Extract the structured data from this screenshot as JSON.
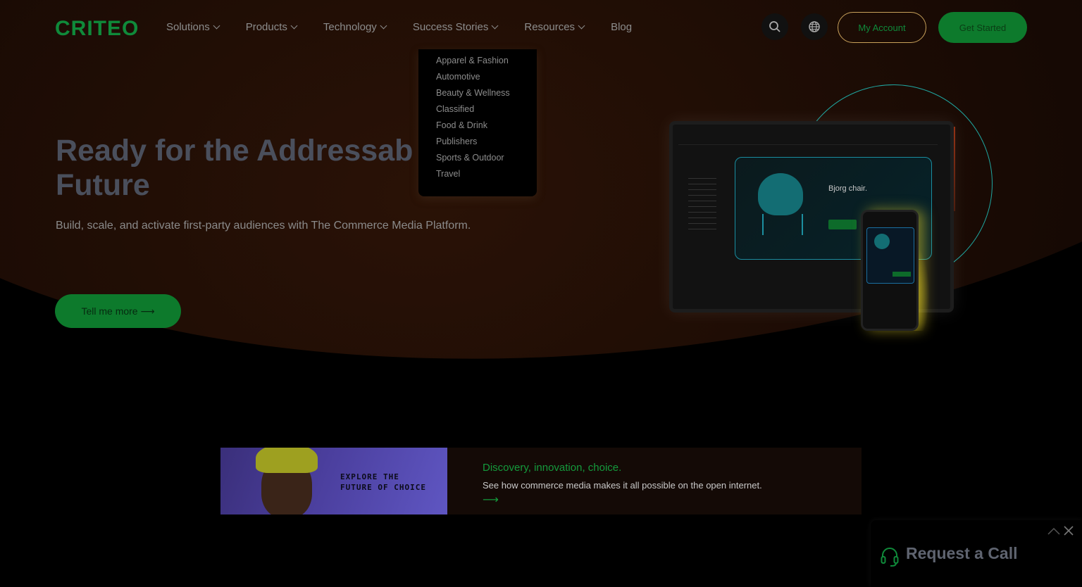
{
  "brand": {
    "logo": "CRITEO",
    "accent": "#0f8a3a"
  },
  "nav": {
    "items": [
      {
        "label": "Solutions",
        "has_dropdown": true
      },
      {
        "label": "Products",
        "has_dropdown": true
      },
      {
        "label": "Technology",
        "has_dropdown": true
      },
      {
        "label": "Success Stories",
        "has_dropdown": true
      },
      {
        "label": "Resources",
        "has_dropdown": true
      },
      {
        "label": "Blog",
        "has_dropdown": false
      }
    ],
    "search_icon": "search-icon",
    "language_icon": "globe-icon",
    "my_account": "My Account",
    "get_started": "Get Started"
  },
  "dropdown": {
    "parent": "Success Stories",
    "items": [
      "Apparel & Fashion",
      "Automotive",
      "Beauty & Wellness",
      "Classified",
      "Food & Drink",
      "Publishers",
      "Sports & Outdoor",
      "Travel"
    ]
  },
  "hero": {
    "title_line1": "Ready for the Addressab",
    "title_line2": "Future",
    "subtitle": "Build, scale, and activate first-party audiences with The Commerce Media Platform.",
    "cta": "Tell me more ⟶",
    "device": {
      "panel_name": "Bjorg chair."
    }
  },
  "banner": {
    "image_tag_line1": "EXPLORE THE",
    "image_tag_line2": "FUTURE OF CHOICE",
    "title": "Discovery, innovation, choice.",
    "description": "See how commerce media makes it all possible on the open internet.",
    "arrow": "⟶"
  },
  "call_widget": {
    "title": "Request a Call",
    "icon": "headset-icon",
    "minimize_icon": "chevron-up-icon",
    "close_icon": "close-icon"
  }
}
